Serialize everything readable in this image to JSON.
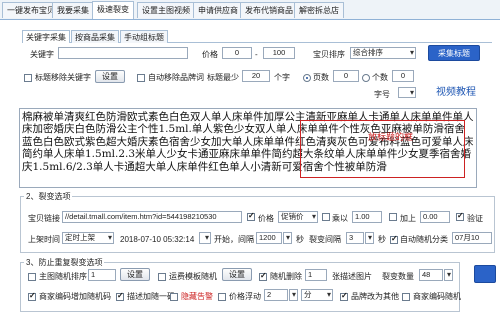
{
  "top_tabs": [
    "一键发布宝贝",
    "我要采集",
    "极速裂变",
    "设置主图视频",
    "申请供应商",
    "发布代销商品",
    "解密拆总店"
  ],
  "sub_tabs": [
    "关键字采集",
    "按商品采集",
    "手动组标题"
  ],
  "keyword_row": {
    "label": "关键字",
    "price_label": "价格",
    "price_from": "0",
    "price_to": "100",
    "sort_value": "宝贝排序",
    "sort_selected": "综合排序",
    "collect_btn": "采集标题"
  },
  "options_row": {
    "remove_keyword": "标题移除关键字",
    "setup_btn": "设置",
    "auto_remove": "自动移除品牌词",
    "min_title_label": "标题最少",
    "min_title_value": "20",
    "chars_unit": "个字",
    "rad_pages": "页数",
    "pages_value": "0",
    "rad_count": "个数",
    "count_value": "0"
  },
  "field_label": "字号",
  "link_text": "视频教程",
  "title_paragraph": "棉麻被单清爽红色防滑欧式素色白色双人单人床单件加厚公主清新亚麻单人卡通单人床单单件单人床加密婚庆白色防滑公主个性1.5ml.单人紫色少女双人单人床单单件个性灰色亚麻被单防滑宿舍蓝色白色欧式紫色超大婚庆素色宿舍少女加大单人床单单件红色清爽灰色可爱布料蓝色可爱单人床简约单人床单1.5ml.2.3米单人少女卡通亚麻床单单件简约超大条纹单人床单单件少女夏季宿舍婚庆1.5ml.6/2.3单人卡通超大单人床单件红色单人小清新可爱宿舍个性被单防滑",
  "note_red": "放标题的框",
  "section2": {
    "title": "2、裂变选项",
    "url_label": "宝贝链接",
    "url_value": "//detail.tmall.com/item.htm?id=544198210530",
    "price_label": "价格",
    "price_sel": "促销价",
    "multiply": "乘以",
    "multiply_val": "1.00",
    "plus": "加上",
    "plus_val": "0.00",
    "verify": "验证",
    "shelf_label": "上架时间",
    "shelf_sel": "定时上架",
    "shelf_time": "2018-07-10 05:32:14",
    "start_interval": "开始，间隔",
    "interval_val": "1200",
    "seconds": "秒",
    "batch_interval": "裂变间隔",
    "batch_val": "3",
    "seconds2": "秒",
    "auto_split": "自动随机分类",
    "split_time": "07月10"
  },
  "section3": {
    "title": "3、防止重复裂变选项",
    "main_random": "主图随机排序",
    "main_random_val": "1",
    "setup": "设置",
    "freight": "运费模板随机",
    "setup2": "设置",
    "random_remove": "随机删除",
    "random_remove_val": "1",
    "remove_main": "张描述图片",
    "split_count": "裂变数量",
    "split_count_val": "48",
    "merchant_code": "商家编码增加随机码",
    "desc_code": "描述加随一码",
    "hide_alert": "隐藏告警",
    "price_float": "价格浮动",
    "price_float_val": "2",
    "unit": "分",
    "fix_label": "品牌改为其他",
    "other_text": "商家编码随机"
  },
  "colors": {
    "accent": "#1e56b3",
    "red": "#cc2222",
    "blue_btn": "#2b63c8"
  }
}
